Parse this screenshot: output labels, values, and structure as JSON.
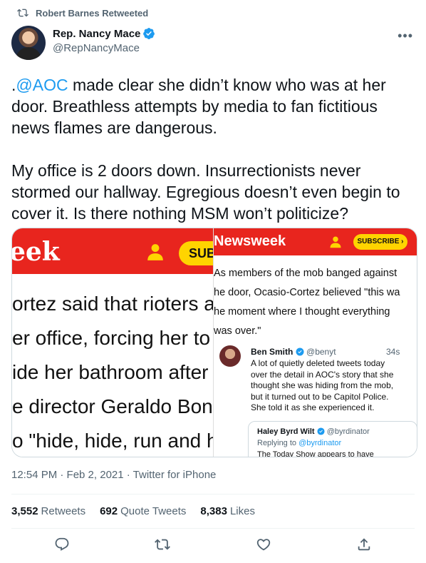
{
  "retweet_context": {
    "label": "Robert Barnes Retweeted"
  },
  "author": {
    "name": "Rep. Nancy Mace",
    "handle": "@RepNancyMace"
  },
  "tweet": {
    "prefix": ".",
    "mention": "@AOC",
    "text": " made clear she didn’t know who was at her door. Breathless attempts by media to fan fictitious news flames are dangerous.\n\nMy office is 2 doors down. Insurrectionists never stormed our hallway. Egregious doesn’t even begin to cover it. Is there nothing MSM won’t politicize?"
  },
  "media": {
    "left": {
      "logo": "eek",
      "subscribe": "SUB",
      "lines": [
        "ortez said that rioters a",
        "er office, forcing her to",
        "ide her bathroom after",
        "e director Geraldo Bonill",
        "o \"hide, hide, run and hi"
      ]
    },
    "right": {
      "logo": "Newsweek",
      "subscribe": "SUBSCRIBE ›",
      "article": "As members of the mob banged against\nhe door, Ocasio-Cortez believed \"this wa\nhe moment where I thought everything\nwas over.\"",
      "embed": {
        "name": "Ben Smith",
        "handle": "@benyt",
        "time": "34s",
        "body": "A lot of quietly deleted tweets today\nover the detail in AOC's story that she\nthought she was hiding from the mob,\nbut it turned out to be Capitol Police.\nShe told it as she experienced it.",
        "nested": {
          "name": "Haley Byrd Wilt",
          "handle": "@byrdinator",
          "replying_label": "Replying to ",
          "replying_handle": "@byrdinator",
          "cut": "The Today Show appears to have"
        }
      }
    }
  },
  "meta": {
    "time": "12:54 PM · Feb 2, 2021 · Twitter for iPhone"
  },
  "stats": {
    "retweets": "3,552",
    "retweets_label": "Retweets",
    "quotes": "692",
    "quotes_label": "Quote Tweets",
    "likes": "8,383",
    "likes_label": "Likes"
  },
  "colors": {
    "accent": "#1d9bf0",
    "newsweek_red": "#e8251e",
    "subscribe_yellow": "#ffd400"
  },
  "icons": [
    "retweet-icon",
    "verified-icon",
    "more-icon",
    "reply-icon",
    "like-icon",
    "share-icon",
    "person-icon"
  ]
}
